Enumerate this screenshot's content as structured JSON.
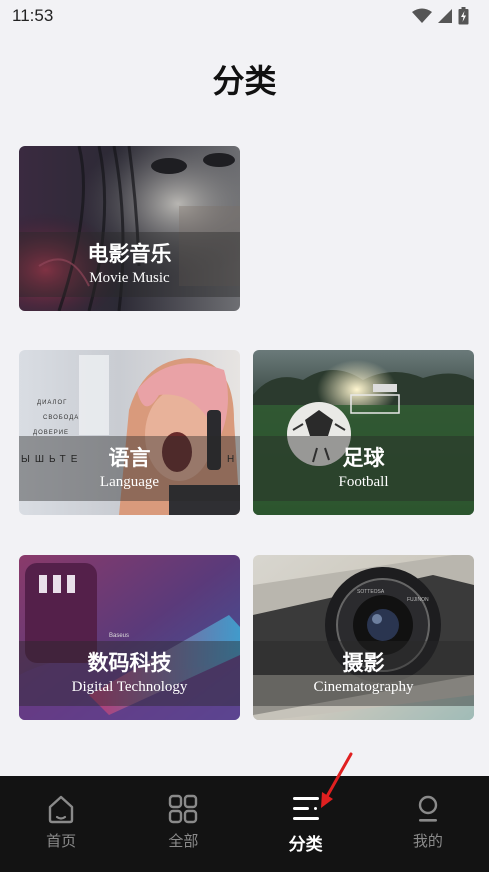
{
  "status_bar": {
    "time": "11:53",
    "icons": [
      "wifi-icon",
      "signal-icon",
      "battery-icon"
    ]
  },
  "page": {
    "title": "分类"
  },
  "categories": [
    {
      "name_zh": "电影音乐",
      "name_en": "Movie Music",
      "image": "movie-music-image"
    },
    {
      "name_zh": "语言",
      "name_en": "Language",
      "image": "language-image",
      "image_text": [
        "ДИАЛОГ",
        "СВОБОДА",
        "ДОВЕРИЕ",
        "ЫШЬТЕ",
        "Н"
      ]
    },
    {
      "name_zh": "足球",
      "name_en": "Football",
      "image": "football-image"
    },
    {
      "name_zh": "数码科技",
      "name_en": "Digital Technology",
      "image": "digital-tech-image",
      "image_text": [
        "Baseus"
      ]
    },
    {
      "name_zh": "摄影",
      "name_en": "Cinematography",
      "image": "camera-image",
      "image_text": [
        "SOTTEOSA",
        "FUJINON"
      ]
    }
  ],
  "bottom_nav": {
    "items": [
      {
        "label": "首页",
        "icon": "home-icon",
        "active": false
      },
      {
        "label": "全部",
        "icon": "grid-icon",
        "active": false
      },
      {
        "label": "分类",
        "icon": "category-list-icon",
        "active": true
      },
      {
        "label": "我的",
        "icon": "profile-icon",
        "active": false
      }
    ]
  },
  "colors": {
    "background": "#f2f2f5",
    "nav_background": "#131313",
    "nav_inactive": "#8a8a8a",
    "nav_active": "#ffffff",
    "annotation_arrow": "#e02020"
  }
}
